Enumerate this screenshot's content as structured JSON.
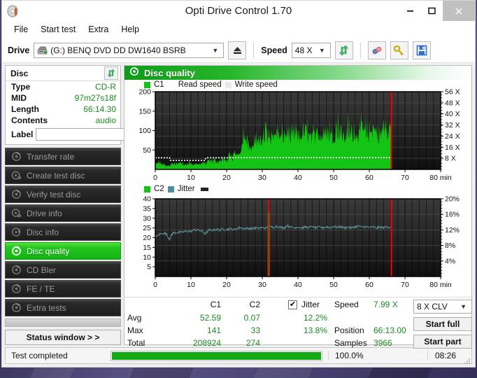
{
  "window": {
    "title": "Opti Drive Control 1.70",
    "icon": "disc-icon",
    "minimize": "–",
    "maximize": "❑",
    "close": "✕"
  },
  "menu": {
    "items": [
      {
        "label": "File"
      },
      {
        "label": "Start test"
      },
      {
        "label": "Extra"
      },
      {
        "label": "Help"
      }
    ]
  },
  "toolbar": {
    "drive_label": "Drive",
    "drive_value": "(G:)   BENQ DVD DD DW1640 BSRB",
    "eject_icon": "eject-icon",
    "speed_label": "Speed",
    "speed_value": "48 X",
    "refresh_icon": "refresh-icon",
    "eraser_icon": "eraser-icon",
    "key_icon": "key-icon",
    "save_icon": "save-icon",
    "dropdown_arrow": "▼"
  },
  "sidebar": {
    "disc_panel": {
      "title": "Disc",
      "refresh_icon": "refresh-icon",
      "rows": [
        {
          "key": "Type",
          "value": "CD-R"
        },
        {
          "key": "MID",
          "value": "97m27s18f"
        },
        {
          "key": "Length",
          "value": "66:14.30"
        },
        {
          "key": "Contents",
          "value": "audio"
        }
      ],
      "label_key": "Label",
      "label_value": "",
      "label_placeholder": "",
      "label_button_icon": "cd-icon"
    },
    "nav_items": [
      {
        "label": "Transfer rate",
        "icon": "disc-scan-icon",
        "active": false
      },
      {
        "label": "Create test disc",
        "icon": "disc-burn-icon",
        "active": false
      },
      {
        "label": "Verify test disc",
        "icon": "disc-check-icon",
        "active": false
      },
      {
        "label": "Drive info",
        "icon": "drive-info-icon",
        "active": false
      },
      {
        "label": "Disc info",
        "icon": "disc-info-icon",
        "active": false
      },
      {
        "label": "Disc quality",
        "icon": "disc-quality-icon",
        "active": true
      },
      {
        "label": "CD Bler",
        "icon": "cd-bler-icon",
        "active": false
      },
      {
        "label": "FE / TE",
        "icon": "fe-te-icon",
        "active": false
      },
      {
        "label": "Extra tests",
        "icon": "extra-tests-icon",
        "active": false
      }
    ],
    "status_window_button": "Status window > >"
  },
  "main": {
    "panel_title": "Disc quality",
    "panel_icon": "disc-quality-icon"
  },
  "chart_data": [
    {
      "id": "c1-chart",
      "type": "area",
      "title": "C1 / Read speed",
      "xlabel": "min",
      "ylabel": "",
      "xlim": [
        0,
        80
      ],
      "ylim": [
        0,
        200
      ],
      "y2lim": [
        0,
        56
      ],
      "y2label": "X",
      "grid": true,
      "legend": [
        {
          "label": "C1",
          "color": "#14c414",
          "swatch": true
        },
        {
          "label": "Read speed",
          "color": "#ffffff",
          "swatch": false
        },
        {
          "label": "Write speed",
          "color": "#dddddd",
          "swatch": true
        }
      ],
      "xticks": [
        0,
        10,
        20,
        30,
        40,
        50,
        60,
        70,
        80
      ],
      "xtick_labels": [
        "0",
        "10",
        "20",
        "30",
        "40",
        "50",
        "60",
        "70",
        "80 min"
      ],
      "yticks": [
        50,
        100,
        150,
        200
      ],
      "ytick_labels": [
        "50",
        "100",
        "150",
        "200"
      ],
      "y2ticks": [
        8,
        16,
        24,
        32,
        40,
        48,
        56
      ],
      "y2tick_labels": [
        "8 X",
        "16 X",
        "24 X",
        "32 X",
        "40 X",
        "48 X",
        "56 X"
      ],
      "data_end_x": 66.2,
      "marker_x": 66.2,
      "marker_color": "#ff0000",
      "series": [
        {
          "name": "C1",
          "color": "#14c414",
          "kind": "area",
          "x": [
            0,
            1,
            2,
            3,
            4,
            5,
            6,
            7,
            8,
            9,
            10,
            11,
            12,
            13,
            14,
            15,
            16,
            17,
            18,
            19,
            20,
            21,
            22,
            23,
            24,
            25,
            26,
            27,
            28,
            29,
            30,
            31,
            32,
            33,
            34,
            35,
            36,
            37,
            38,
            39,
            40,
            41,
            42,
            43,
            44,
            45,
            46,
            47,
            48,
            49,
            50,
            51,
            52,
            53,
            54,
            55,
            56,
            57,
            58,
            59,
            60,
            61,
            62,
            63,
            64,
            65,
            66
          ],
          "values": [
            14,
            20,
            16,
            12,
            13,
            18,
            15,
            21,
            14,
            17,
            19,
            16,
            15,
            22,
            18,
            26,
            24,
            28,
            25,
            31,
            30,
            38,
            44,
            41,
            52,
            126,
            70,
            62,
            74,
            96,
            84,
            122,
            101,
            92,
            118,
            88,
            104,
            116,
            94,
            106,
            112,
            98,
            122,
            104,
            96,
            118,
            108,
            100,
            124,
            112,
            104,
            130,
            116,
            98,
            126,
            110,
            120,
            104,
            128,
            114,
            106,
            132,
            118,
            110,
            124,
            116,
            112
          ]
        },
        {
          "name": "Read speed",
          "color": "#ffffff",
          "kind": "line",
          "x": [
            0,
            2,
            4,
            4.2,
            6,
            8,
            10,
            12,
            14,
            14.2,
            16,
            18,
            20,
            22,
            24,
            26,
            30,
            35,
            40,
            45,
            50,
            55,
            60,
            66
          ],
          "values_x_axis": [
            30,
            30,
            30,
            23,
            23,
            23,
            23,
            23,
            23,
            30,
            30,
            30,
            30,
            30,
            30,
            30,
            30,
            30,
            30,
            30,
            30,
            30,
            30,
            30
          ]
        }
      ]
    },
    {
      "id": "c2-jitter-chart",
      "type": "line",
      "title": "C2 / Jitter",
      "xlabel": "min",
      "xlim": [
        0,
        80
      ],
      "ylim": [
        0,
        40
      ],
      "y2lim": [
        0,
        20
      ],
      "y2label": "%",
      "grid": true,
      "legend": [
        {
          "label": "C2",
          "color": "#14c414",
          "swatch": true
        },
        {
          "label": "Jitter",
          "color": "#4e8f99",
          "swatch": true
        }
      ],
      "xticks": [
        0,
        10,
        20,
        30,
        40,
        50,
        60,
        70,
        80
      ],
      "xtick_labels": [
        "0",
        "10",
        "20",
        "30",
        "40",
        "50",
        "60",
        "70",
        "80 min"
      ],
      "yticks": [
        5,
        10,
        15,
        20,
        25,
        30,
        35,
        40
      ],
      "ytick_labels": [
        "5",
        "10",
        "15",
        "20",
        "25",
        "30",
        "35",
        "40"
      ],
      "y2ticks": [
        4,
        8,
        12,
        16,
        20
      ],
      "y2tick_labels": [
        "4%",
        "8%",
        "12%",
        "16%",
        "20%"
      ],
      "markers": [
        {
          "x": 31.8,
          "color": "#ff0000"
        },
        {
          "x": 66.2,
          "color": "#ff0000"
        }
      ],
      "data_end_x": 66.2,
      "series": [
        {
          "name": "Jitter",
          "color": "#5d949c",
          "kind": "line",
          "x": [
            0,
            1,
            2,
            3,
            4,
            4.5,
            5,
            6,
            7,
            8,
            9,
            10,
            11,
            12,
            13,
            14,
            15,
            16,
            17,
            18,
            19,
            20,
            21,
            22,
            23,
            24,
            25,
            26,
            27,
            28,
            29,
            30,
            31,
            32,
            33,
            34,
            35,
            36,
            37,
            38,
            39,
            40,
            41,
            42,
            43,
            44,
            45,
            46,
            47,
            48,
            49,
            50,
            51,
            52,
            53,
            54,
            55,
            56,
            57,
            58,
            59,
            60,
            61,
            62,
            63,
            64,
            65,
            66
          ],
          "values": [
            20.2,
            21.5,
            22.3,
            22.0,
            19.3,
            21.2,
            22.4,
            22.7,
            22.6,
            23.0,
            23.4,
            23.2,
            24.1,
            23.9,
            23.4,
            22.1,
            23.8,
            23.9,
            24.2,
            23.9,
            24.4,
            24.2,
            24.6,
            24.1,
            24.8,
            25.2,
            24.6,
            24.9,
            24.6,
            25.0,
            24.8,
            25.2,
            25.0,
            25.6,
            25.2,
            25.9,
            25.4,
            25.0,
            26.2,
            25.4,
            25.1,
            25.6,
            25.0,
            25.5,
            25.2,
            25.7,
            25.0,
            25.4,
            25.1,
            25.6,
            25.2,
            25.8,
            25.3,
            25.6,
            25.1,
            25.4,
            25.0,
            25.6,
            25.9,
            25.3,
            25.7,
            25.2,
            25.5,
            25.0,
            25.4,
            25.1,
            25.6,
            25.4
          ]
        },
        {
          "name": "C2",
          "color": "#14c414",
          "kind": "bars",
          "x": [
            31.8
          ],
          "values": [
            33
          ]
        }
      ]
    }
  ],
  "stats": {
    "col_headers": [
      "C1",
      "C2"
    ],
    "row_labels": [
      "Avg",
      "Max",
      "Total"
    ],
    "c1": {
      "avg": "52.59",
      "max": "141",
      "total": "208924"
    },
    "c2": {
      "avg": "0.07",
      "max": "33",
      "total": "274"
    },
    "jitter": {
      "checkbox_label": "Jitter",
      "checked": true,
      "check_glyph": "✔",
      "avg": "12.2%",
      "max": "13.8%"
    },
    "speed": {
      "label": "Speed",
      "value": "7.99 X"
    },
    "position": {
      "label": "Position",
      "value": "66:13.00"
    },
    "samples": {
      "label": "Samples",
      "value": "3966"
    },
    "clv_select": "8 X CLV",
    "clv_arrow": "▼",
    "start_full_button": "Start full",
    "start_part_button": "Start part"
  },
  "statusbar": {
    "message": "Test completed",
    "progress_percent": 100.0,
    "progress_text": "100.0%",
    "elapsed": "08:26",
    "grip_icon": "resize-grip-icon"
  },
  "colors": {
    "accent_green": "#14c414",
    "value_green": "#1d8a22",
    "jitter_teal": "#5d949c",
    "marker_red": "#ff0000",
    "chart_bg": "#1c1c1c"
  }
}
